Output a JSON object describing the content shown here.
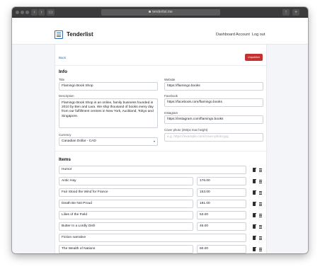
{
  "browser": {
    "url": "tenderlist.me"
  },
  "nav": {
    "brand": "Tenderlist",
    "links": [
      "Dashboard",
      "Account",
      "Log out"
    ]
  },
  "toolbar": {
    "back_label": "Back",
    "unpublish_label": "Unpublish"
  },
  "info": {
    "heading": "Info",
    "title_label": "Title",
    "title_value": "Flamingo Book Shop",
    "description_label": "Description",
    "description_value": "Flamingo Book Shop is an online, family business founded in 2010 by Ben and Lara. We ship thousand of books every day from our fulfillment centres in New York, Auckland, Tokyo and Singapore.",
    "currency_label": "Currency",
    "currency_value": "Canadian Dollar - CAD",
    "website_label": "Website",
    "website_value": "https://flamingo.books",
    "facebook_label": "Facebook",
    "facebook_value": "https://facebook.com/flamingo.books",
    "instagram_label": "Instagram",
    "instagram_value": "https://instagram.com/flamingo.books",
    "cover_label": "Cover photo (250px max height)",
    "cover_placeholder": "e.g. https://example.com/cover-photo.jpg"
  },
  "items": {
    "heading": "Items",
    "rows": [
      {
        "name": "Humor",
        "price": ""
      },
      {
        "name": "Antic Hay",
        "price": "176.00"
      },
      {
        "name": "Fair Stood the Wind for France",
        "price": "153.00"
      },
      {
        "name": "Death Be Not Proud",
        "price": "181.00"
      },
      {
        "name": "Lilies of the Field",
        "price": "53.00"
      },
      {
        "name": "Butter In a Lordly Dish",
        "price": "46.00"
      },
      {
        "name": "Fiction narrative",
        "price": ""
      },
      {
        "name": "The Wealth of Nations",
        "price": "60.00"
      }
    ]
  },
  "icons": {
    "trash": "trash-icon",
    "drag": "drag-handle-icon"
  }
}
